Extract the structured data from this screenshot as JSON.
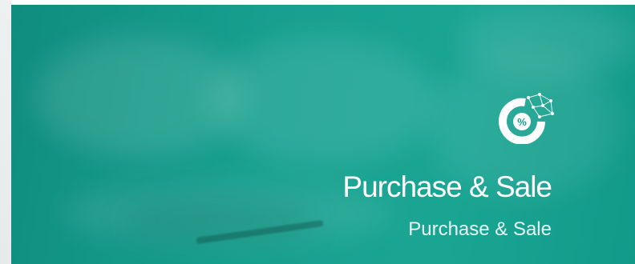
{
  "hero": {
    "title": "Purchase & Sale",
    "subtitle": "Purchase & Sale",
    "badge_icon": "percent-donut-network-icon",
    "badge_symbol": "%",
    "background_color": "#17a08f",
    "text_color": "#ffffff"
  }
}
